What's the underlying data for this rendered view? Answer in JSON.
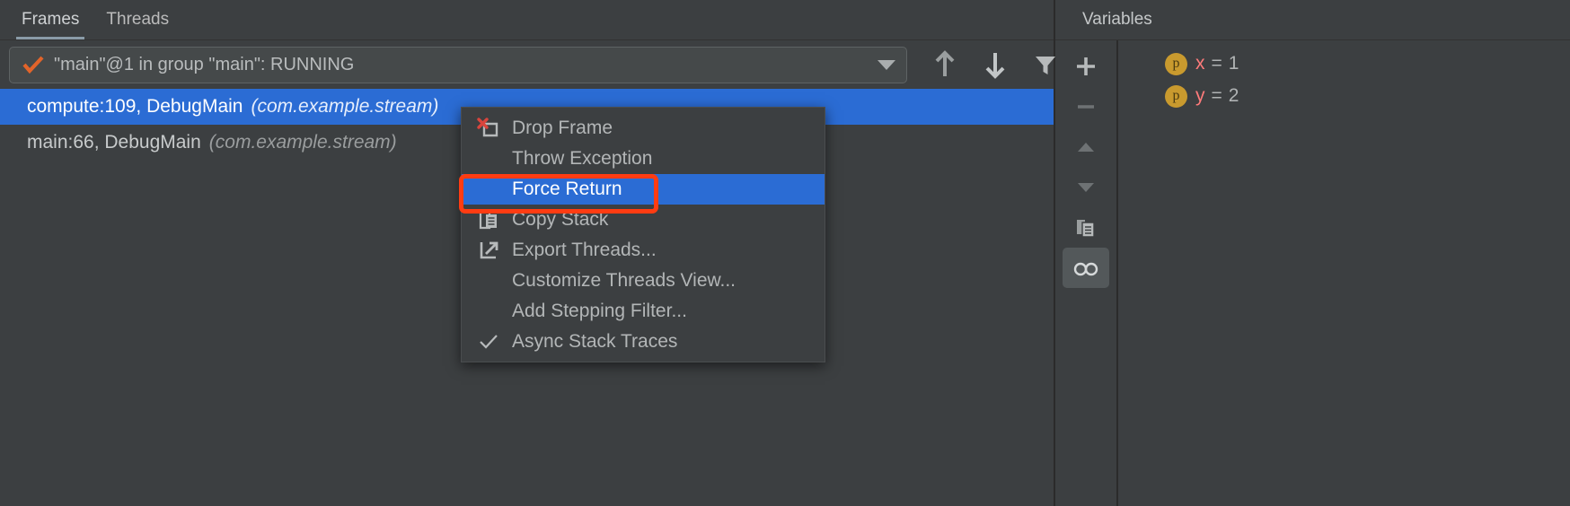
{
  "frames_panel": {
    "tabs": [
      {
        "id": "frames",
        "label": "Frames",
        "active": true
      },
      {
        "id": "threads",
        "label": "Threads",
        "active": false
      }
    ],
    "thread_selector": {
      "status_icon": "orange-checkmark-icon",
      "value": "\"main\"@1 in group \"main\": RUNNING",
      "dropdown_icon": "chevron-down-icon"
    },
    "toolbar": [
      {
        "id": "up",
        "icon": "arrow-up-icon",
        "tooltip": "Up"
      },
      {
        "id": "down",
        "icon": "arrow-down-icon",
        "tooltip": "Down"
      },
      {
        "id": "filter",
        "icon": "filter-funnel-icon",
        "tooltip": "Filter"
      }
    ],
    "stack_frames": [
      {
        "method": "compute:109, DebugMain",
        "package": "(com.example.stream)",
        "selected": true
      },
      {
        "method": "main:66, DebugMain",
        "package": "(com.example.stream)",
        "selected": false
      }
    ]
  },
  "context_menu": {
    "items": [
      {
        "id": "drop-frame",
        "label": "Drop Frame",
        "icon": "drop-frame-icon",
        "highlight": false
      },
      {
        "id": "throw-exception",
        "label": "Throw Exception",
        "icon": "",
        "highlight": false
      },
      {
        "id": "force-return",
        "label": "Force Return",
        "icon": "",
        "highlight": true
      },
      {
        "id": "copy-stack",
        "label": "Copy Stack",
        "icon": "copy-icon",
        "highlight": false
      },
      {
        "id": "export-threads",
        "label": "Export Threads...",
        "icon": "export-icon",
        "highlight": false
      },
      {
        "id": "customize-threads-view",
        "label": "Customize Threads View...",
        "icon": "",
        "highlight": false
      },
      {
        "id": "add-stepping-filter",
        "label": "Add Stepping Filter...",
        "icon": "",
        "highlight": false
      },
      {
        "id": "async-stack-traces",
        "label": "Async Stack Traces",
        "icon": "checkmark-icon",
        "highlight": false
      }
    ]
  },
  "annotation": {
    "type": "rectangle-highlight",
    "target": "Force Return",
    "color": "#ff3c12"
  },
  "variables_panel": {
    "title": "Variables",
    "toolbar": [
      {
        "id": "add",
        "icon": "plus-icon",
        "active": false
      },
      {
        "id": "remove",
        "icon": "minus-icon",
        "active": false
      },
      {
        "id": "move-up",
        "icon": "triangle-up-icon",
        "active": false
      },
      {
        "id": "move-down",
        "icon": "triangle-down-icon",
        "active": false
      },
      {
        "id": "copy",
        "icon": "copy-pages-icon",
        "active": false
      },
      {
        "id": "watches",
        "icon": "glasses-icon",
        "active": true
      }
    ],
    "variables": [
      {
        "badge": "p",
        "name": "x",
        "operator": "=",
        "value": "1"
      },
      {
        "badge": "p",
        "name": "y",
        "operator": "=",
        "value": "2"
      }
    ]
  },
  "colors": {
    "background": "#3c3f41",
    "selection_blue": "#2b6cd4",
    "annotation_red": "#ff3c12",
    "accent_orange": "#d2691e",
    "badge_gold": "#c99a2e",
    "var_name_pink": "#ff7b7b"
  }
}
